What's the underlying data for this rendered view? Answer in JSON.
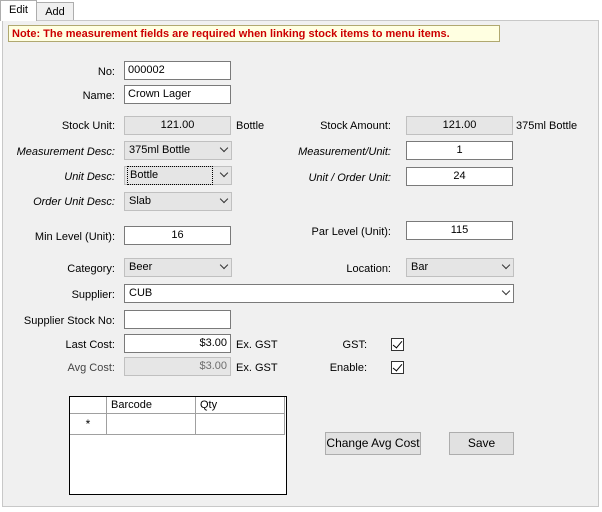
{
  "tabs": [
    {
      "label": "Edit"
    },
    {
      "label": "Add"
    }
  ],
  "note": "Note: The measurement fields are required when linking stock items to menu items.",
  "form": {
    "no_label": "No:",
    "no_value": "000002",
    "name_label": "Name:",
    "name_value": "Crown Lager",
    "stock_unit_label": "Stock Unit:",
    "stock_unit_value": "121.00",
    "stock_unit_suffix": "Bottle",
    "stock_amount_label": "Stock Amount:",
    "stock_amount_value": "121.00",
    "stock_amount_suffix": "375ml Bottle",
    "measurement_desc_label": "Measurement Desc:",
    "measurement_desc_value": "375ml Bottle",
    "measurement_unit_label": "Measurement/Unit:",
    "measurement_unit_value": "1",
    "unit_desc_label": "Unit Desc:",
    "unit_desc_value": "Bottle",
    "unit_order_label": "Unit / Order Unit:",
    "unit_order_value": "24",
    "order_unit_desc_label": "Order Unit Desc:",
    "order_unit_desc_value": "Slab",
    "min_level_label": "Min Level (Unit):",
    "min_level_value": "16",
    "par_level_label": "Par Level (Unit):",
    "par_level_value": "115",
    "category_label": "Category:",
    "category_value": "Beer",
    "location_label": "Location:",
    "location_value": "Bar",
    "supplier_label": "Supplier:",
    "supplier_value": "CUB",
    "supplier_stock_no_label": "Supplier Stock No:",
    "supplier_stock_no_value": "",
    "last_cost_label": "Last Cost:",
    "last_cost_value": "$3.00",
    "last_cost_suffix": "Ex. GST",
    "avg_cost_label": "Avg Cost:",
    "avg_cost_value": "$3.00",
    "avg_cost_suffix": "Ex. GST",
    "gst_label": "GST:",
    "gst_checked": true,
    "enable_label": "Enable:",
    "enable_checked": true
  },
  "barcode_grid": {
    "columns": [
      "Barcode",
      "Qty"
    ],
    "new_row_marker": "*"
  },
  "buttons": {
    "change_avg_cost": "Change Avg Cost",
    "save": "Save"
  },
  "colors": {
    "note_text": "#cc0000",
    "note_bg": "#ffffe1",
    "panel_bg": "#f0f0f0"
  }
}
